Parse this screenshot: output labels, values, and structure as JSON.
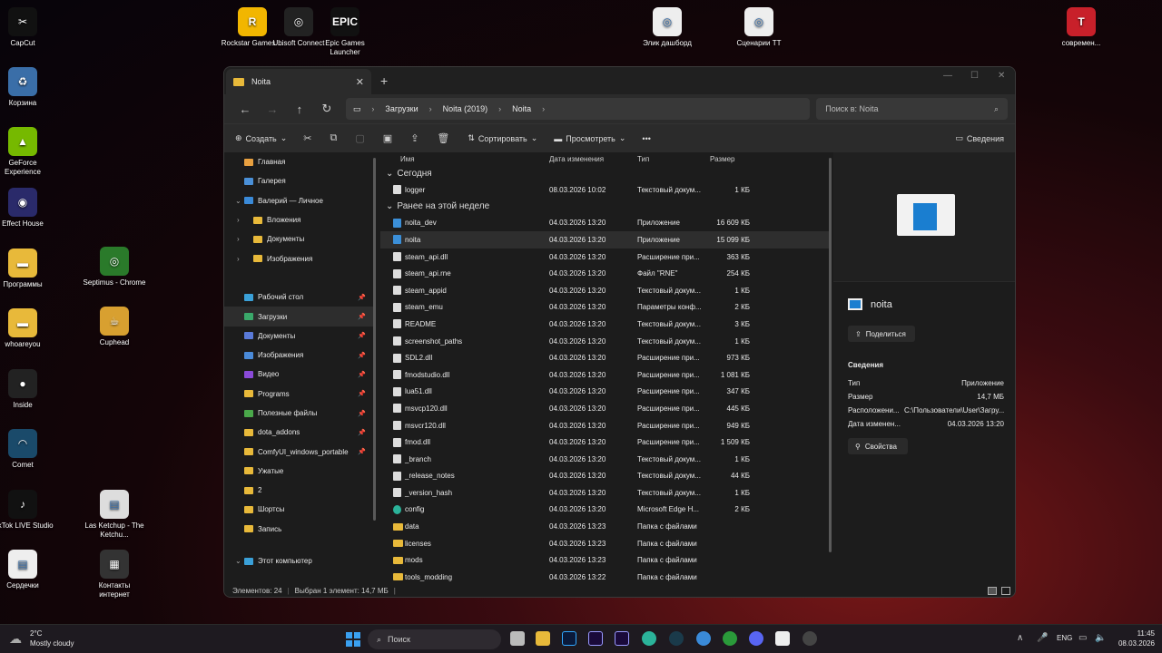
{
  "desktop": {
    "icons": [
      {
        "label": "CapCut",
        "color": "#111",
        "glyph": "✂"
      },
      {
        "label": "Корзина",
        "color": "#3a6ea8",
        "glyph": "♻"
      },
      {
        "label": "GeForce Experience",
        "color": "#76b900",
        "glyph": "▲"
      },
      {
        "label": "Effect House",
        "color": "#2a2a6a",
        "glyph": "◉"
      },
      {
        "label": "Программы",
        "color": "#e8b93a",
        "glyph": "▬"
      },
      {
        "label": "whoareyou",
        "color": "#e8b93a",
        "glyph": "▬"
      },
      {
        "label": "Inside",
        "color": "#222",
        "glyph": "●"
      },
      {
        "label": "Comet",
        "color": "#1a4a6a",
        "glyph": "◠"
      },
      {
        "label": "TikTok LIVE Studio",
        "color": "#111",
        "glyph": "♪"
      },
      {
        "label": "Сердечки",
        "color": "#eee",
        "glyph": "▤"
      },
      {
        "label": "Septimus - Chrome",
        "color": "#2a7a2a",
        "glyph": "◎"
      },
      {
        "label": "Cuphead",
        "color": "#d8a030",
        "glyph": "☕"
      },
      {
        "label": "Las Ketchup - The Ketchu...",
        "color": "#ddd",
        "glyph": "▤"
      },
      {
        "label": "Контакты интернет",
        "color": "#333",
        "glyph": "▦"
      },
      {
        "label": "Rockstar Games ...",
        "color": "#f2b600",
        "glyph": "R"
      },
      {
        "label": "Ubisoft Connect",
        "color": "#222",
        "glyph": "◎"
      },
      {
        "label": "Epic Games Launcher",
        "color": "#111",
        "glyph": "EPIC"
      },
      {
        "label": "Элик дашборд",
        "color": "#eee",
        "glyph": "◎"
      },
      {
        "label": "Сценарии ТТ",
        "color": "#eee",
        "glyph": "◎"
      },
      {
        "label": "современ...",
        "color": "#c8202a",
        "glyph": "T"
      }
    ]
  },
  "window": {
    "tab_title": "Noita",
    "tab_close": "✕",
    "new_tab": "+",
    "controls": {
      "minimize": "—",
      "maximize": "☐",
      "close": "✕"
    },
    "nav": {
      "back": "←",
      "forward": "→",
      "up": "↑",
      "refresh": "↻"
    },
    "breadcrumb": [
      "Загрузки",
      "Noita (2019)",
      "Noita"
    ],
    "search_placeholder": "Поиск в: Noita",
    "toolbar": {
      "create": "Создать",
      "sort": "Сортировать",
      "view": "Просмотреть",
      "more": "•••",
      "details": "Сведения"
    },
    "sidebar": {
      "items": [
        {
          "label": "Главная",
          "color": "#e8a040",
          "pin": false,
          "chev": ""
        },
        {
          "label": "Галерея",
          "color": "#4a90d8",
          "pin": false,
          "chev": ""
        },
        {
          "label": "Валерий — Личное",
          "color": "#3a8ad8",
          "pin": false,
          "chev": "v"
        },
        {
          "label": "Вложения",
          "color": "#e8b93a",
          "pin": false,
          "chev": ">"
        },
        {
          "label": "Документы",
          "color": "#e8b93a",
          "pin": false,
          "chev": ">"
        },
        {
          "label": "Изображения",
          "color": "#e8b93a",
          "pin": false,
          "chev": ">"
        },
        {
          "label": "",
          "color": "",
          "pin": false,
          "chev": ""
        },
        {
          "label": "Рабочий стол",
          "color": "#3aa0d8",
          "pin": true,
          "chev": ""
        },
        {
          "label": "Загрузки",
          "color": "#3aa86a",
          "pin": true,
          "chev": ""
        },
        {
          "label": "Документы",
          "color": "#5a7ad8",
          "pin": true,
          "chev": ""
        },
        {
          "label": "Изображения",
          "color": "#4a8ad8",
          "pin": true,
          "chev": ""
        },
        {
          "label": "Видео",
          "color": "#8a4ad8",
          "pin": true,
          "chev": ""
        },
        {
          "label": "Programs",
          "color": "#e8b93a",
          "pin": true,
          "chev": ""
        },
        {
          "label": "Полезные файлы",
          "color": "#4aa84a",
          "pin": true,
          "chev": ""
        },
        {
          "label": "dota_addons",
          "color": "#e8b93a",
          "pin": true,
          "chev": ""
        },
        {
          "label": "ComfyUI_windows_portable",
          "color": "#e8b93a",
          "pin": true,
          "chev": ""
        },
        {
          "label": "Ужатые",
          "color": "#e8b93a",
          "pin": false,
          "chev": ""
        },
        {
          "label": "2",
          "color": "#e8b93a",
          "pin": false,
          "chev": ""
        },
        {
          "label": "Шортсы",
          "color": "#e8b93a",
          "pin": false,
          "chev": ""
        },
        {
          "label": "Запись",
          "color": "#e8b93a",
          "pin": false,
          "chev": ""
        }
      ],
      "this_pc": "Этот компьютер"
    },
    "columns": {
      "name": "Имя",
      "date": "Дата изменения",
      "type": "Тип",
      "size": "Размер"
    },
    "groups": {
      "today": "Сегодня",
      "week": "Ранее на этой неделе"
    },
    "today_files": [
      {
        "name": "logger",
        "date": "08.03.2026 10:02",
        "type": "Текстовый докум...",
        "size": "1 КБ",
        "icon": "doc"
      }
    ],
    "week_files": [
      {
        "name": "noita_dev",
        "date": "04.03.2026 13:20",
        "type": "Приложение",
        "size": "16 609 КБ",
        "icon": "app"
      },
      {
        "name": "noita",
        "date": "04.03.2026 13:20",
        "type": "Приложение",
        "size": "15 099 КБ",
        "icon": "app",
        "selected": true
      },
      {
        "name": "steam_api.dll",
        "date": "04.03.2026 13:20",
        "type": "Расширение при...",
        "size": "363 КБ",
        "icon": "doc"
      },
      {
        "name": "steam_api.rne",
        "date": "04.03.2026 13:20",
        "type": "Файл \"RNE\"",
        "size": "254 КБ",
        "icon": "doc"
      },
      {
        "name": "steam_appid",
        "date": "04.03.2026 13:20",
        "type": "Текстовый докум...",
        "size": "1 КБ",
        "icon": "doc"
      },
      {
        "name": "steam_emu",
        "date": "04.03.2026 13:20",
        "type": "Параметры конф...",
        "size": "2 КБ",
        "icon": "doc"
      },
      {
        "name": "README",
        "date": "04.03.2026 13:20",
        "type": "Текстовый докум...",
        "size": "3 КБ",
        "icon": "doc"
      },
      {
        "name": "screenshot_paths",
        "date": "04.03.2026 13:20",
        "type": "Текстовый докум...",
        "size": "1 КБ",
        "icon": "doc"
      },
      {
        "name": "SDL2.dll",
        "date": "04.03.2026 13:20",
        "type": "Расширение при...",
        "size": "973 КБ",
        "icon": "doc"
      },
      {
        "name": "fmodstudio.dll",
        "date": "04.03.2026 13:20",
        "type": "Расширение при...",
        "size": "1 081 КБ",
        "icon": "doc"
      },
      {
        "name": "lua51.dll",
        "date": "04.03.2026 13:20",
        "type": "Расширение при...",
        "size": "347 КБ",
        "icon": "doc"
      },
      {
        "name": "msvcp120.dll",
        "date": "04.03.2026 13:20",
        "type": "Расширение при...",
        "size": "445 КБ",
        "icon": "doc"
      },
      {
        "name": "msvcr120.dll",
        "date": "04.03.2026 13:20",
        "type": "Расширение при...",
        "size": "949 КБ",
        "icon": "doc"
      },
      {
        "name": "fmod.dll",
        "date": "04.03.2026 13:20",
        "type": "Расширение при...",
        "size": "1 509 КБ",
        "icon": "doc"
      },
      {
        "name": "_branch",
        "date": "04.03.2026 13:20",
        "type": "Текстовый докум...",
        "size": "1 КБ",
        "icon": "doc"
      },
      {
        "name": "_release_notes",
        "date": "04.03.2026 13:20",
        "type": "Текстовый докум...",
        "size": "44 КБ",
        "icon": "doc"
      },
      {
        "name": "_version_hash",
        "date": "04.03.2026 13:20",
        "type": "Текстовый докум...",
        "size": "1 КБ",
        "icon": "doc"
      },
      {
        "name": "config",
        "date": "04.03.2026 13:20",
        "type": "Microsoft Edge H...",
        "size": "2 КБ",
        "icon": "edge"
      },
      {
        "name": "data",
        "date": "04.03.2026 13:23",
        "type": "Папка с файлами",
        "size": "",
        "icon": "folder"
      },
      {
        "name": "licenses",
        "date": "04.03.2026 13:23",
        "type": "Папка с файлами",
        "size": "",
        "icon": "folder"
      },
      {
        "name": "mods",
        "date": "04.03.2026 13:23",
        "type": "Папка с файлами",
        "size": "",
        "icon": "folder"
      },
      {
        "name": "tools_modding",
        "date": "04.03.2026 13:22",
        "type": "Папка с файлами",
        "size": "",
        "icon": "folder"
      }
    ],
    "details_pane": {
      "name": "noita",
      "share": "Поделиться",
      "section": "Сведения",
      "props": [
        {
          "k": "Тип",
          "v": "Приложение"
        },
        {
          "k": "Размер",
          "v": "14,7 МБ"
        },
        {
          "k": "Расположени...",
          "v": "C:\\Пользователи\\User\\Загру..."
        },
        {
          "k": "Дата изменен...",
          "v": "04.03.2026 13:20"
        }
      ],
      "properties_btn": "Свойства"
    },
    "status": {
      "count": "Элементов: 24",
      "selected": "Выбран 1 элемент: 14,7 МБ"
    }
  },
  "taskbar": {
    "weather_temp": "2°C",
    "weather_text": "Mostly cloudy",
    "search": "Поиск",
    "lang": "ENG",
    "time": "11:45",
    "date": "08.03.2026"
  }
}
